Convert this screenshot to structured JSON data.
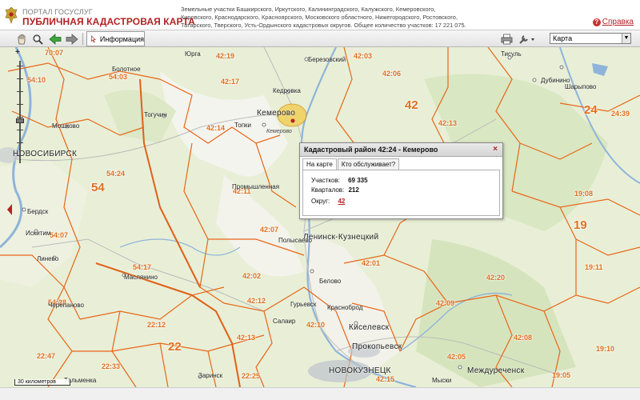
{
  "header": {
    "portal_name": "ПОРТАЛ ГОСУСЛУГ",
    "app_title": "ПУБЛИЧНАЯ КАДАСТРОВАЯ КАРТА",
    "regions_text": "Земельные участки Башкирского, Иркутского, Калининградского, Калужского, Кемеровского, Кировского, Краснодарского, Красноярского, Московского областного, Нижегородского, Ростовского, Татарского, Тверского, Усть-Ордынского кадастровых округов. Общее количество участков: 17 221 075.",
    "help_label": "Справка"
  },
  "toolbar": {
    "info_label": "Информация",
    "layer_select_value": "Карта"
  },
  "colors": {
    "brand_red": "#b22222",
    "boundary_orange": "#e8661a",
    "map_green": "#dfe9c8",
    "river_blue": "#8fb4d9"
  },
  "map": {
    "region_labels": [
      {
        "id": "r1",
        "text": "70:07"
      },
      {
        "id": "r2",
        "text": "54:10"
      },
      {
        "id": "r3",
        "text": "54:03"
      },
      {
        "id": "r4",
        "text": "42:19"
      },
      {
        "id": "r5",
        "text": "42:03"
      },
      {
        "id": "r6",
        "text": "42:17"
      },
      {
        "id": "r7",
        "text": "42:06"
      },
      {
        "id": "r8",
        "text": "42:14"
      },
      {
        "id": "r9",
        "text": "42:13"
      },
      {
        "id": "r10",
        "text": "24:39"
      },
      {
        "id": "r11",
        "text": "54:24"
      },
      {
        "id": "r12",
        "text": "42:11"
      },
      {
        "id": "r13",
        "text": "19:08"
      },
      {
        "id": "r14",
        "text": "54:07"
      },
      {
        "id": "r15",
        "text": "42:07"
      },
      {
        "id": "r16",
        "text": "42:01"
      },
      {
        "id": "r17",
        "text": "54:17"
      },
      {
        "id": "r18",
        "text": "42:02"
      },
      {
        "id": "r19",
        "text": "19:11"
      },
      {
        "id": "r20",
        "text": "54:28"
      },
      {
        "id": "r21",
        "text": "42:12"
      },
      {
        "id": "r22",
        "text": "42:09"
      },
      {
        "id": "r23",
        "text": "22:12"
      },
      {
        "id": "r24",
        "text": "42:10"
      },
      {
        "id": "r25",
        "text": "42:13"
      },
      {
        "id": "r26",
        "text": "42:08"
      },
      {
        "id": "r27",
        "text": "22:47"
      },
      {
        "id": "r28",
        "text": "22:33"
      },
      {
        "id": "r29",
        "text": "42:05"
      },
      {
        "id": "r30",
        "text": "19:10"
      },
      {
        "id": "r31",
        "text": "22:25"
      },
      {
        "id": "r32",
        "text": "19:05"
      },
      {
        "id": "r33",
        "text": "42:15"
      },
      {
        "id": "r34",
        "text": "42:20"
      }
    ],
    "big_labels": [
      {
        "id": "b1",
        "text": "54"
      },
      {
        "id": "b2",
        "text": "42"
      },
      {
        "id": "b3",
        "text": "24"
      },
      {
        "id": "b4",
        "text": "19"
      },
      {
        "id": "b5",
        "text": "22"
      }
    ],
    "cities_major": [
      {
        "id": "c1",
        "text": "НОВОСИБИРСК"
      },
      {
        "id": "c2",
        "text": "Кемерово"
      },
      {
        "id": "c3",
        "text": "Ленинск-Кузнецкий"
      },
      {
        "id": "c4",
        "text": "Киселевск"
      },
      {
        "id": "c5",
        "text": "Прокопьевск"
      },
      {
        "id": "c6",
        "text": "НОВОКУЗНЕЦК"
      },
      {
        "id": "c7",
        "text": "Междуреченск"
      }
    ],
    "cities_minor": [
      {
        "id": "m1",
        "text": "Тогучин"
      },
      {
        "id": "m2",
        "text": "Мошково"
      },
      {
        "id": "m3",
        "text": "Болотное"
      },
      {
        "id": "m4",
        "text": "Юрга"
      },
      {
        "id": "m5",
        "text": "Березовский"
      },
      {
        "id": "m6",
        "text": "Кедровка"
      },
      {
        "id": "m7",
        "text": "Топки"
      },
      {
        "id": "m8",
        "text": "Промышленная"
      },
      {
        "id": "m9",
        "text": "Бердск"
      },
      {
        "id": "m10",
        "text": "Искитим"
      },
      {
        "id": "m11",
        "text": "Линево"
      },
      {
        "id": "m12",
        "text": "Маслянино"
      },
      {
        "id": "m13",
        "text": "Черепаново"
      },
      {
        "id": "m14",
        "text": "Белово"
      },
      {
        "id": "m15",
        "text": "Гурьевск"
      },
      {
        "id": "m16",
        "text": "Красноброд"
      },
      {
        "id": "m17",
        "text": "Салаир"
      },
      {
        "id": "m18",
        "text": "Тальменка"
      },
      {
        "id": "m19",
        "text": "Заринск"
      },
      {
        "id": "m20",
        "text": "Дубинино"
      },
      {
        "id": "m21",
        "text": "Шарыпово"
      },
      {
        "id": "m22",
        "text": "Тисуль"
      },
      {
        "id": "m23",
        "text": "Кемерово"
      },
      {
        "id": "m24",
        "text": "Мыски"
      },
      {
        "id": "m25",
        "text": "Полысаево"
      }
    ],
    "scale_label": "30 километров"
  },
  "popup": {
    "title": "Кадастровый район 42:24 - Кемерово",
    "tabs": [
      "На карте",
      "Кто обслуживает?"
    ],
    "parcels_label": "Участков:",
    "parcels_value": "69 335",
    "quarters_label": "Кварталов:",
    "quarters_value": "212",
    "okrug_label": "Округ:",
    "okrug_value": "42"
  }
}
